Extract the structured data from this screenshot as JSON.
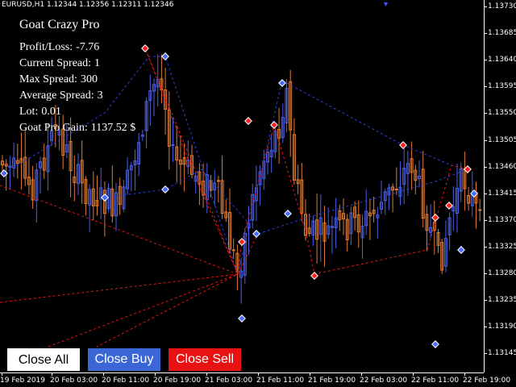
{
  "symbol_label": "EURUSD,H1  1.12344 1.12356 1.12311 1.12346",
  "info_panel": {
    "title": "Goat Crazy Pro",
    "lines": [
      {
        "label": "Profit/Loss:",
        "value": "-7.76"
      },
      {
        "label": "Current Spread:",
        "value": "1"
      },
      {
        "label": "Max Spread:",
        "value": "300"
      },
      {
        "label": "Average Spread:",
        "value": "3"
      },
      {
        "label": "Lot:",
        "value": "0.01"
      },
      {
        "label": "Goat Pro Gain:",
        "value": "1137.52 $"
      }
    ]
  },
  "buttons": {
    "close_all": "Close All",
    "close_buy": "Close Buy",
    "close_sell": "Close Sell"
  },
  "price_scale": [
    "1.13730",
    "1.13685",
    "1.13640",
    "1.13595",
    "1.13550",
    "1.13505",
    "1.13460",
    "1.13415",
    "1.13370",
    "1.13325",
    "1.13280",
    "1.13235",
    "1.13190",
    "1.13145"
  ],
  "time_scale": [
    "19 Feb 2019",
    "20 Feb 03:00",
    "20 Feb 11:00",
    "20 Feb 19:00",
    "21 Feb 03:00",
    "21 Feb 11:00",
    "21 Feb 19:00",
    "22 Feb 03:00",
    "22 Feb 11:00",
    "22 Feb 19:00"
  ],
  "colors": {
    "bull": "#4c5fe6",
    "bear": "#e07a33",
    "sell_line": "#e81212",
    "buy_line": "#2a3fd8",
    "close_buy_button": "#3a66d6",
    "close_sell_button": "#e81212"
  },
  "chart_data": {
    "type": "candlestick",
    "symbol": "EURUSD",
    "timeframe": "H1",
    "ohlc_current": {
      "open": 1.12344,
      "high": 1.12356,
      "low": 1.12311,
      "close": 1.12346
    }
  }
}
